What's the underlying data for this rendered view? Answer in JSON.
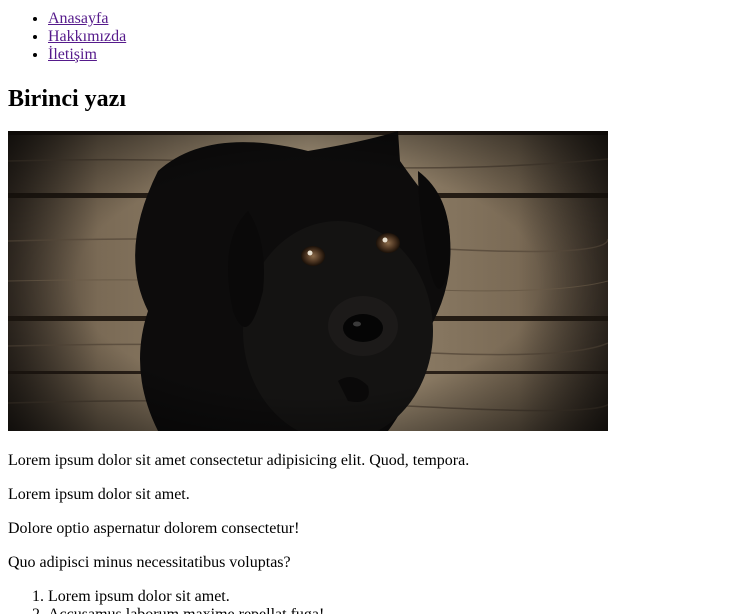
{
  "nav": {
    "items": [
      {
        "label": "Anasayfa"
      },
      {
        "label": "Hakkımızda"
      },
      {
        "label": "İletişim"
      }
    ]
  },
  "article": {
    "title": "Birinci yazı",
    "paragraphs": [
      "Lorem ipsum dolor sit amet consectetur adipisicing elit. Quod, tempora.",
      "Lorem ipsum dolor sit amet.",
      "Dolore optio aspernatur dolorem consectetur!",
      "Quo adipisci minus necessitatibus voluptas?"
    ],
    "list": [
      "Lorem ipsum dolor sit amet.",
      "Accusamus laborum maxime repellat fuga!"
    ]
  }
}
